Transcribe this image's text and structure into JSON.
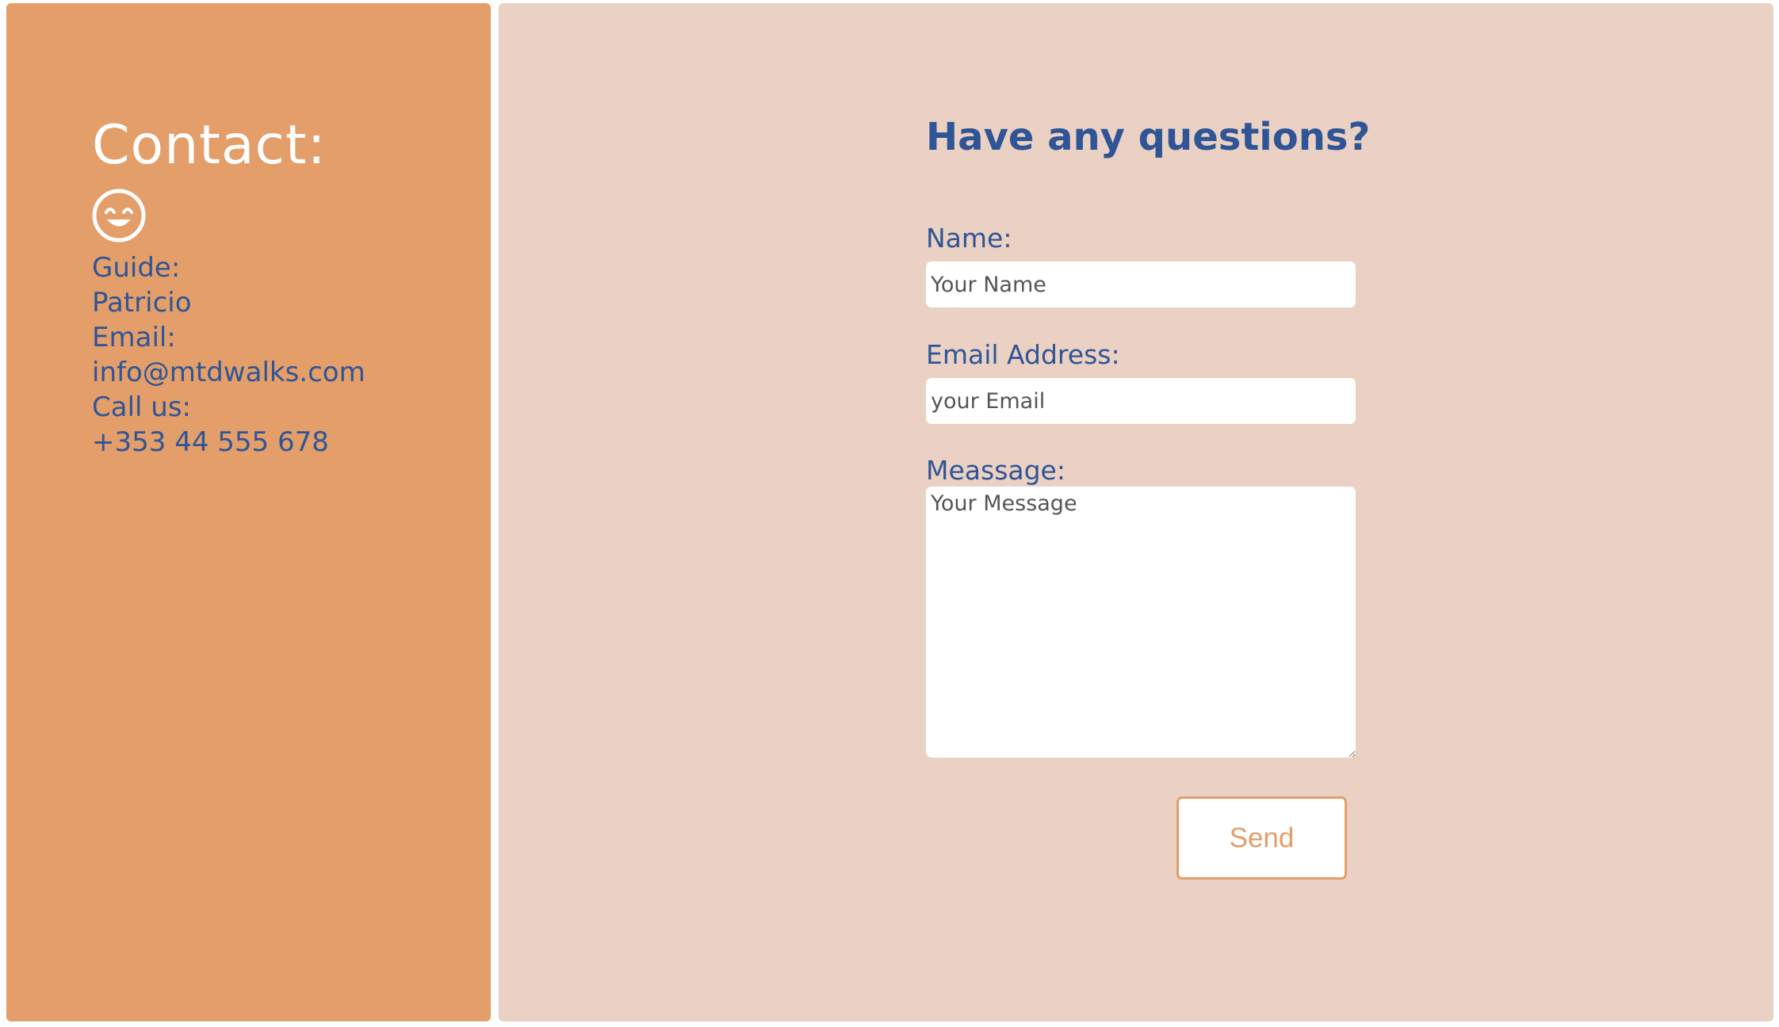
{
  "contact_panel": {
    "title": "Contact:",
    "icon": "smiley-face-icon",
    "lines": [
      "Guide:",
      "Patricio",
      "Email:",
      "info@mtdwalks.com",
      "Call us:",
      "+353 44 555 678"
    ]
  },
  "form": {
    "heading": "Have any questions?",
    "name_label": "Name:",
    "name_placeholder": "Your Name",
    "email_label": "Email Address:",
    "email_placeholder": "your Email",
    "message_label": "Meassage:",
    "message_placeholder": "Your Message",
    "send_label": "Send"
  },
  "colors": {
    "left_panel_bg": "#e39e69",
    "right_panel_bg": "#ead1c3",
    "text_blue": "#2f5597",
    "white": "#ffffff"
  }
}
